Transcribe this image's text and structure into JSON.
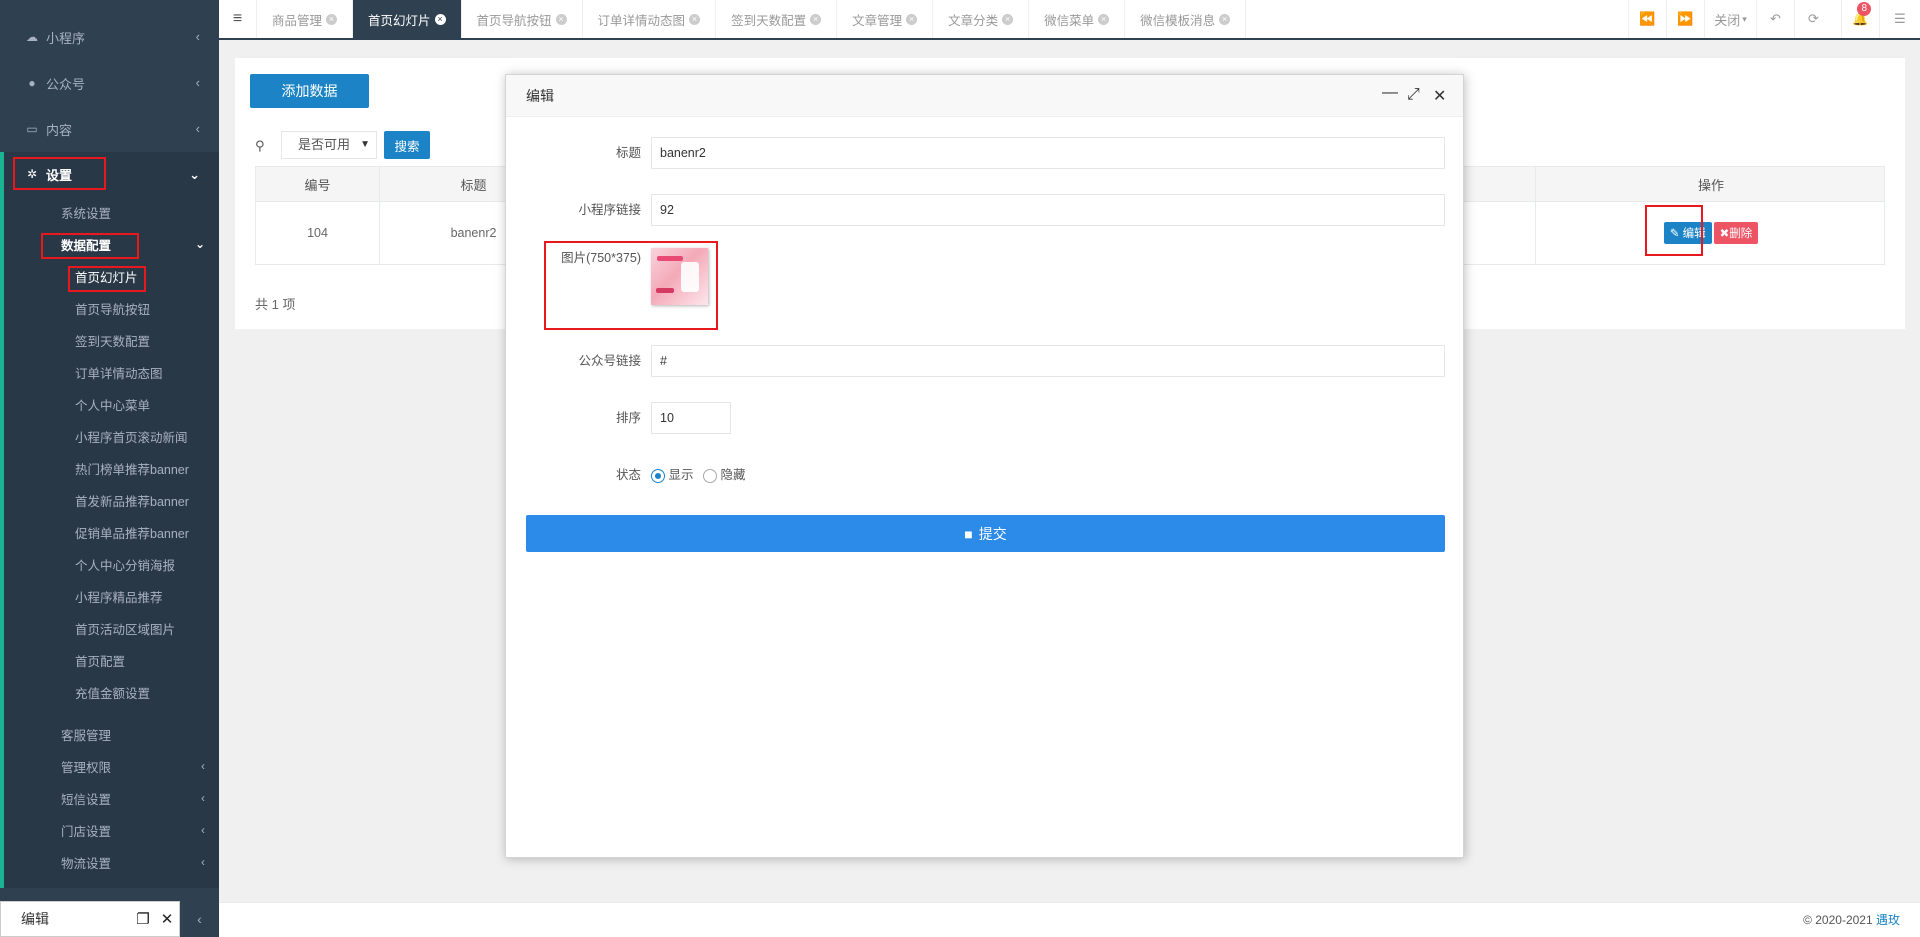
{
  "sidebar": {
    "top_items": [
      {
        "label": "小程序",
        "icon": "cloud-icon"
      },
      {
        "label": "公众号",
        "icon": "wechat-icon"
      },
      {
        "label": "内容",
        "icon": "book-icon"
      }
    ],
    "settings": {
      "label": "设置",
      "icon": "gear-icon"
    },
    "sub_items": [
      {
        "label": "系统设置"
      },
      {
        "label": "数据配置"
      }
    ],
    "data_config_items": [
      "首页幻灯片",
      "首页导航按钮",
      "签到天数配置",
      "订单详情动态图",
      "个人中心菜单",
      "小程序首页滚动新闻",
      "热门榜单推荐banner",
      "首发新品推荐banner",
      "促销单品推荐banner",
      "个人中心分销海报",
      "小程序精品推荐",
      "首页活动区域图片",
      "首页配置",
      "充值金额设置"
    ],
    "more_items": [
      "客服管理",
      "管理权限",
      "短信设置",
      "门店设置",
      "物流设置"
    ]
  },
  "taskbar": {
    "title": "编辑"
  },
  "tabs": [
    "商品管理",
    "首页幻灯片",
    "首页导航按钮",
    "订单详情动态图",
    "签到天数配置",
    "文章管理",
    "文章分类",
    "微信菜单",
    "微信模板消息"
  ],
  "active_tab_index": 1,
  "topbar": {
    "close_label": "关闭",
    "notification_count": "8"
  },
  "panel": {
    "add_button": "添加数据",
    "filter_value": "是否可用",
    "search_button": "搜索",
    "columns": {
      "id": "编号",
      "title": "标题",
      "actions": "操作"
    },
    "row": {
      "id": "104",
      "title": "banenr2"
    },
    "edit_label": "编辑",
    "delete_label": "删除",
    "total": "共 1 项"
  },
  "modal": {
    "title": "编辑",
    "fields": {
      "title_label": "标题",
      "title_value": "banenr2",
      "mini_link_label": "小程序链接",
      "mini_link_value": "92",
      "image_label": "图片(750*375)",
      "mp_link_label": "公众号链接",
      "mp_link_value": "#",
      "sort_label": "排序",
      "sort_value": "10",
      "status_label": "状态",
      "status_show": "显示",
      "status_hide": "隐藏"
    },
    "selected_status": "显示",
    "submit_label": "提交"
  },
  "footer": {
    "copyright": "© 2020-2021 ",
    "link": "遇玫"
  },
  "colors": {
    "sidebar_bg": "#2f4050",
    "primary": "#1c84c6",
    "danger": "#ed5565",
    "highlight": "#e8181e"
  }
}
